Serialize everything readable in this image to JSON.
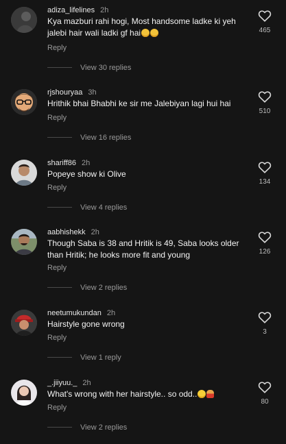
{
  "comments": [
    {
      "username": "adiza_lifelines",
      "time": "2h",
      "text": "Kya mazburi rahi hogi, Most handsome ladke ki yeh jalebi hair wali ladki gf hai",
      "emojis": [
        "sad-face",
        "sad-face"
      ],
      "reply_label": "Reply",
      "view_replies": "View 30 replies",
      "likes": "465",
      "avatar": "dark-profile"
    },
    {
      "username": "rjshouryaa",
      "time": "3h",
      "text": "Hrithik bhai Bhabhi ke sir me Jalebiyan lagi hui hai",
      "emojis": [],
      "reply_label": "Reply",
      "view_replies": "View 16 replies",
      "likes": "510",
      "avatar": "cartoon-glasses"
    },
    {
      "username": "shariff86",
      "time": "2h",
      "text": "Popeye show ki Olive",
      "emojis": [],
      "reply_label": "Reply",
      "view_replies": "View 4 replies",
      "likes": "134",
      "avatar": "man-light-background"
    },
    {
      "username": "aabhishekk",
      "time": "2h",
      "text": "Though Saba is 38 and Hritik is 49, Saba looks older than Hritik; he looks more fit and young",
      "emojis": [],
      "reply_label": "Reply",
      "view_replies": "View 2 replies",
      "likes": "126",
      "avatar": "man-outdoor"
    },
    {
      "username": "neetumukundan",
      "time": "2h",
      "text": "Hairstyle gone wrong",
      "emojis": [],
      "reply_label": "Reply",
      "view_replies": "View 1 reply",
      "likes": "3",
      "avatar": "red-cap"
    },
    {
      "username": "_.jiiyuu._",
      "time": "2h",
      "text": "What's wrong with her hairstyle.. so odd..",
      "emojis": [
        "grin-face",
        "person-gesturing"
      ],
      "reply_label": "Reply",
      "view_replies": "View 2 replies",
      "likes": "80",
      "avatar": "woman-white-outfit"
    }
  ],
  "icons": {
    "like": "heart-outline-icon"
  },
  "colors": {
    "background": "#151515",
    "primary_text": "#f4f4f4",
    "secondary_text": "#9a9a9a"
  }
}
